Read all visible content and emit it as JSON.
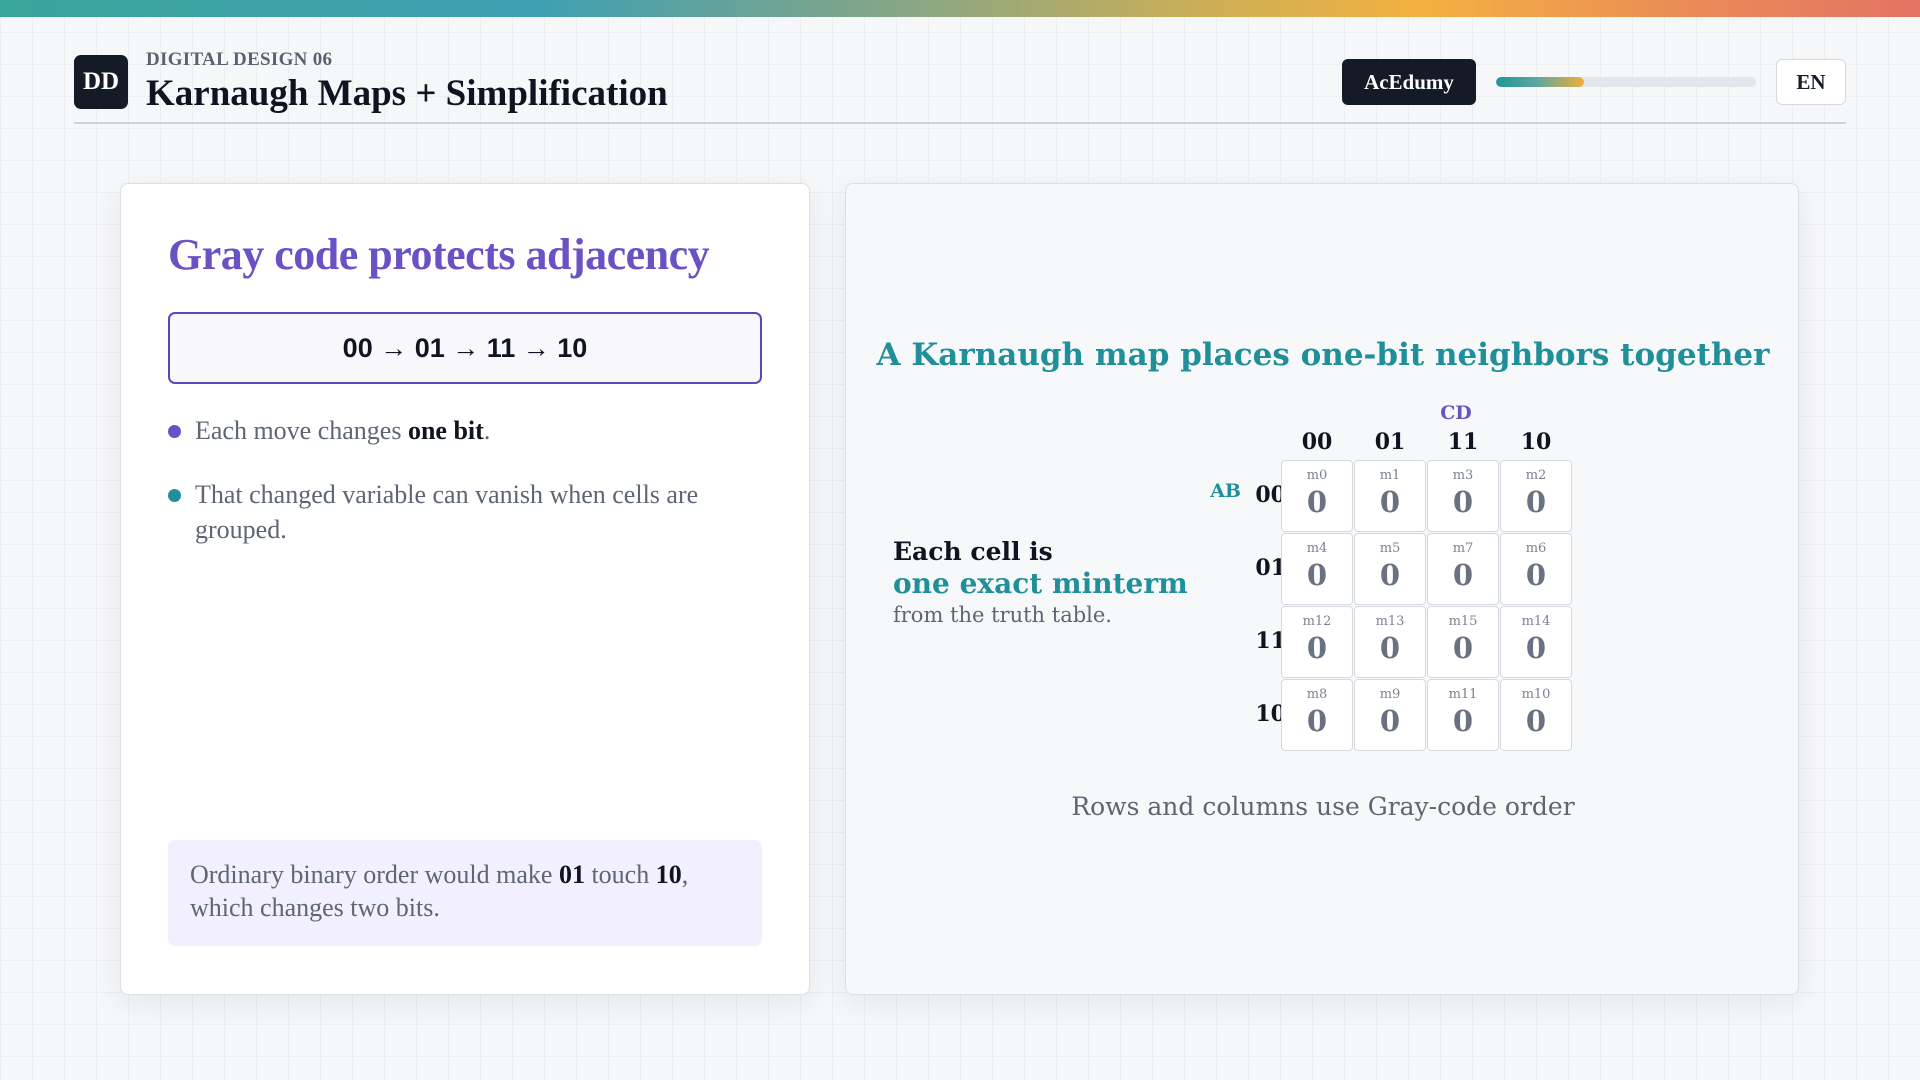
{
  "header": {
    "logo": "DD",
    "eyebrow": "DIGITAL DESIGN 06",
    "title": "Karnaugh Maps + Simplification",
    "brand": "AcEdumy",
    "progress_fraction": 0.34,
    "language": "EN"
  },
  "left_card": {
    "heading": "Gray code protects adjacency",
    "sequence": "00 → 01 → 11 → 10",
    "bullets": [
      {
        "pre": "Each move changes ",
        "bold": "one bit",
        "post": "."
      },
      {
        "pre": "That changed variable can vanish when cells are grouped.",
        "bold": "",
        "post": ""
      }
    ],
    "note": {
      "pre": "Ordinary binary order would make ",
      "bold1": "01",
      "mid": " touch ",
      "bold2": "10",
      "post": ", which changes two bits."
    }
  },
  "right_card": {
    "heading": "A Karnaugh map places one-bit neighbors together",
    "cell_text": {
      "line1": "Each cell is",
      "line2": "one exact minterm",
      "line3": "from the truth table."
    },
    "col_var": "CD",
    "row_var": "AB",
    "col_labels": [
      "00",
      "01",
      "11",
      "10"
    ],
    "row_labels": [
      "00",
      "01",
      "11",
      "10"
    ],
    "cells": [
      [
        {
          "m": "m0",
          "v": "0"
        },
        {
          "m": "m1",
          "v": "0"
        },
        {
          "m": "m3",
          "v": "0"
        },
        {
          "m": "m2",
          "v": "0"
        }
      ],
      [
        {
          "m": "m4",
          "v": "0"
        },
        {
          "m": "m5",
          "v": "0"
        },
        {
          "m": "m7",
          "v": "0"
        },
        {
          "m": "m6",
          "v": "0"
        }
      ],
      [
        {
          "m": "m12",
          "v": "0"
        },
        {
          "m": "m13",
          "v": "0"
        },
        {
          "m": "m15",
          "v": "0"
        },
        {
          "m": "m14",
          "v": "0"
        }
      ],
      [
        {
          "m": "m8",
          "v": "0"
        },
        {
          "m": "m9",
          "v": "0"
        },
        {
          "m": "m11",
          "v": "0"
        },
        {
          "m": "m10",
          "v": "0"
        }
      ]
    ],
    "caption": "Rows and columns use Gray-code order"
  },
  "colors": {
    "purple_accent": "#6a52c4",
    "teal_accent": "#1f8f99",
    "dark": "#141a26"
  }
}
